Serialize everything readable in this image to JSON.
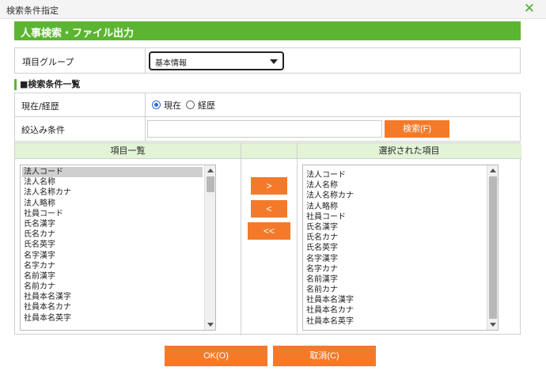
{
  "window": {
    "title": "検索条件指定",
    "close_symbol": "✕"
  },
  "header": {
    "title": "人事検索・ファイル出力"
  },
  "item_group": {
    "label": "項目グループ",
    "selected": "基本情報"
  },
  "conditions": {
    "heading": "■検索条件一覧",
    "status_label": "現在/経歴",
    "radio_current": "現在",
    "radio_history": "経歴",
    "filter_label": "絞込み条件",
    "filter_value": "",
    "search_button": "検索(F)"
  },
  "lists": {
    "available_header": "項目一覧",
    "selected_header": "選択された項目",
    "available_items": [
      "法人コード",
      "法人名称",
      "法人名称カナ",
      "法人略称",
      "社員コード",
      "氏名漢字",
      "氏名カナ",
      "氏名英字",
      "名字漢字",
      "名字カナ",
      "名前漢字",
      "名前カナ",
      "社員本名漢字",
      "社員本名カナ",
      "社員本名英字"
    ],
    "selected_items": [
      "法人コード",
      "法人名称",
      "法人名称カナ",
      "法人略称",
      "社員コード",
      "氏名漢字",
      "氏名カナ",
      "氏名英字",
      "名字漢字",
      "名字カナ",
      "名前漢字",
      "名前カナ",
      "社員本名漢字",
      "社員本名カナ",
      "社員本名英字"
    ],
    "add_button": ">",
    "remove_button": "<",
    "remove_all_button": "<<"
  },
  "footer": {
    "ok_button": "OK(O)",
    "cancel_button": "取消(C)"
  },
  "colors": {
    "accent_green": "#5cb532",
    "header_light_green": "#e2f3d6",
    "button_orange": "#f47a2a"
  }
}
